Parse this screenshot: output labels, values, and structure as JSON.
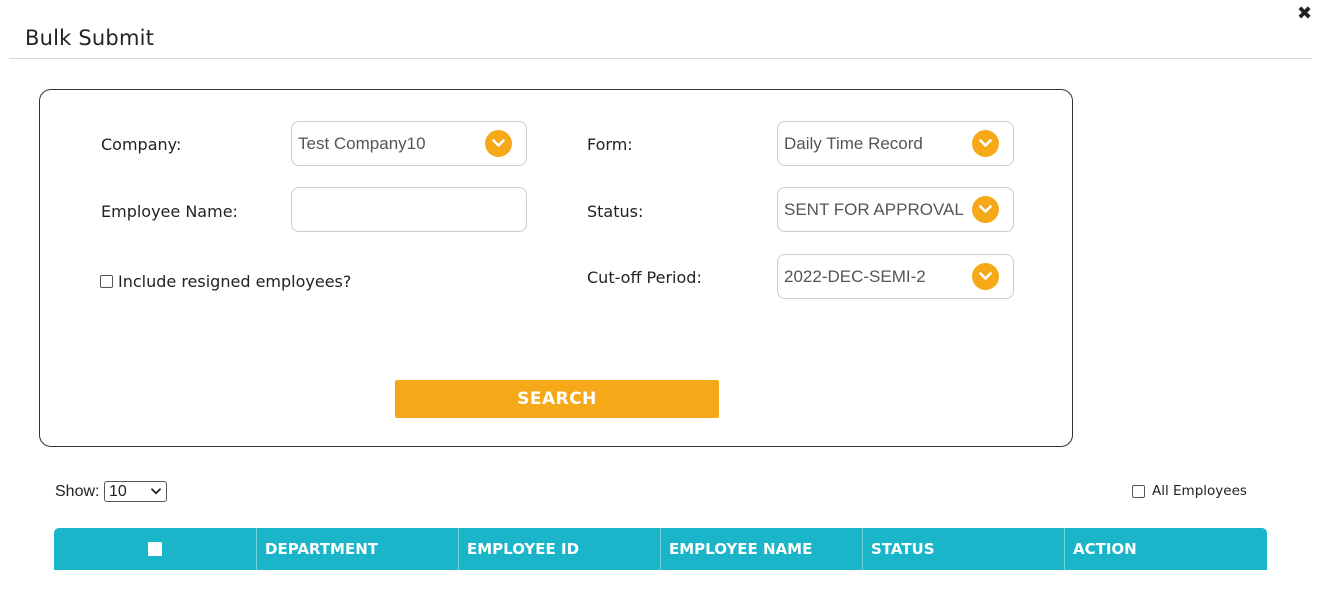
{
  "dialog": {
    "title": "Bulk Submit",
    "close_label": "✖"
  },
  "filters": {
    "company": {
      "label": "Company:",
      "value": "Test Company10"
    },
    "employee_name": {
      "label": "Employee Name:",
      "value": ""
    },
    "include_resigned": {
      "label": "Include resigned employees?",
      "checked": false
    },
    "form": {
      "label": "Form:",
      "value": "Daily Time Record"
    },
    "status": {
      "label": "Status:",
      "value": "SENT FOR APPROVAL"
    },
    "cutoff": {
      "label": "Cut-off Period:",
      "value": "2022-DEC-SEMI-2"
    },
    "search_label": "SEARCH"
  },
  "table_controls": {
    "show_label": "Show:",
    "show_value": "10",
    "all_employees_label": "All Employees"
  },
  "table": {
    "headers": [
      "DEPARTMENT",
      "EMPLOYEE ID",
      "EMPLOYEE NAME",
      "STATUS",
      "ACTION"
    ]
  },
  "colors": {
    "accent": "#f5a818",
    "table_header": "#1ab5c8"
  },
  "icons": {
    "dropdown": "chevron-down-icon",
    "close": "close-icon"
  }
}
